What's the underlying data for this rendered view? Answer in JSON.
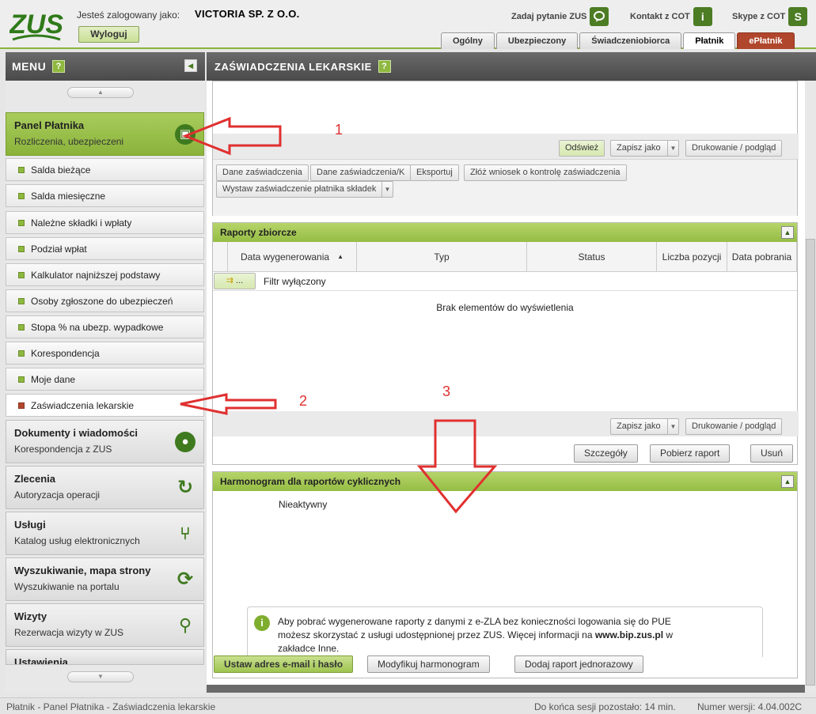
{
  "header": {
    "logo_text": "ZUS",
    "logged_label": "Jesteś zalogowany jako:",
    "logged_name": "VICTORIA SP. Z O.O.",
    "logout_label": "Wyloguj",
    "links": [
      {
        "label": "Zadaj pytanie ZUS",
        "icon": "chat-icon"
      },
      {
        "label": "Kontakt z COT",
        "icon": "info-icon"
      },
      {
        "label": "Skype z COT",
        "icon": "skype-icon"
      }
    ],
    "tabs": [
      "Ogólny",
      "Ubezpieczony",
      "Świadczeniobiorca",
      "Płatnik",
      "ePłatnik"
    ],
    "active_tab": "Płatnik"
  },
  "sidebar": {
    "title": "MENU",
    "help": "?",
    "panel_platnika": {
      "title": "Panel Płatnika",
      "subtitle": "Rozliczenia, ubezpieczeni"
    },
    "items": [
      "Salda bieżące",
      "Salda miesięczne",
      "Należne składki i wpłaty",
      "Podział wpłat",
      "Kalkulator najniższej podstawy",
      "Osoby zgłoszone do ubezpieczeń",
      "Stopa % na ubezp. wypadkowe",
      "Korespondencja",
      "Moje dane",
      "Zaświadczenia lekarskie"
    ],
    "active_item": "Zaświadczenia lekarskie",
    "panels": [
      {
        "title": "Dokumenty i wiadomości",
        "subtitle": "Korespondencja z ZUS",
        "icon": "speech-bubble-icon"
      },
      {
        "title": "Zlecenia",
        "subtitle": "Autoryzacja operacji",
        "icon": "refresh-icon"
      },
      {
        "title": "Usługi",
        "subtitle": "Katalog usług elektronicznych",
        "icon": "fork-icon"
      },
      {
        "title": "Wyszukiwanie, mapa strony",
        "subtitle": "Wyszukiwanie na portalu",
        "icon": "sync-icon"
      },
      {
        "title": "Wizyty",
        "subtitle": "Rezerwacja wizyty w ZUS",
        "icon": "walking-person-icon"
      },
      {
        "title": "Ustawienia",
        "subtitle": "",
        "icon": "gear-icon"
      }
    ]
  },
  "main": {
    "title": "ZAŚWIADCZENIA LEKARSKIE",
    "help": "?",
    "top_toolbar": {
      "refresh": "Odśwież",
      "save_as": "Zapisz jako",
      "print": "Drukowanie / podgląd"
    },
    "actions": [
      "Dane zaświadczenia",
      "Dane zaświadczenia/K",
      "Eksportuj",
      "Złóż wniosek o kontrolę zaświadczenia"
    ],
    "issue_btn": "Wystaw zaświadczenie płatnika składek",
    "reports": {
      "title": "Raporty zbiorcze",
      "columns": [
        "Data wygenerowania",
        "Typ",
        "Status",
        "Liczba pozycji",
        "Data pobrania"
      ],
      "sort_indicator": "▲",
      "filter_btn": "...",
      "filter_text": "Filtr wyłączony",
      "empty_text": "Brak elementów do wyświetlenia",
      "save_as": "Zapisz jako",
      "print": "Drukowanie / podgląd",
      "buttons": [
        "Szczegóły",
        "Pobierz raport",
        "Usuń"
      ]
    },
    "schedule": {
      "title": "Harmonogram dla raportów cyklicznych",
      "status": "Nieaktywny",
      "info_line1": "Aby pobrać wygenerowane raporty z danymi z e-ZLA bez konieczności logowania się do PUE",
      "info_line2_pre": "możesz skorzystać z usługi udostępnionej przez ZUS. Więcej informacji na",
      "info_link": "www.bip.zus.pl",
      "info_line2_post": "w",
      "info_line3": "zakładce Inne.",
      "buttons": [
        "Ustaw adres e-mail i hasło",
        "Modyfikuj harmonogram",
        "Dodaj raport jednorazowy"
      ]
    }
  },
  "annotations": [
    "1",
    "2",
    "3"
  ],
  "statusbar": {
    "breadcrumb": "Płatnik - Panel Płatnika - Zaświadczenia lekarskie",
    "session": "Do końca sesji pozostało: 14 min.",
    "version": "Numer wersji: 4.04.002C"
  },
  "colors": {
    "green": "#95bd44",
    "dark_green": "#4c7c24",
    "eplatnik_red": "#b0462c",
    "annotation_red": "#e03030"
  }
}
